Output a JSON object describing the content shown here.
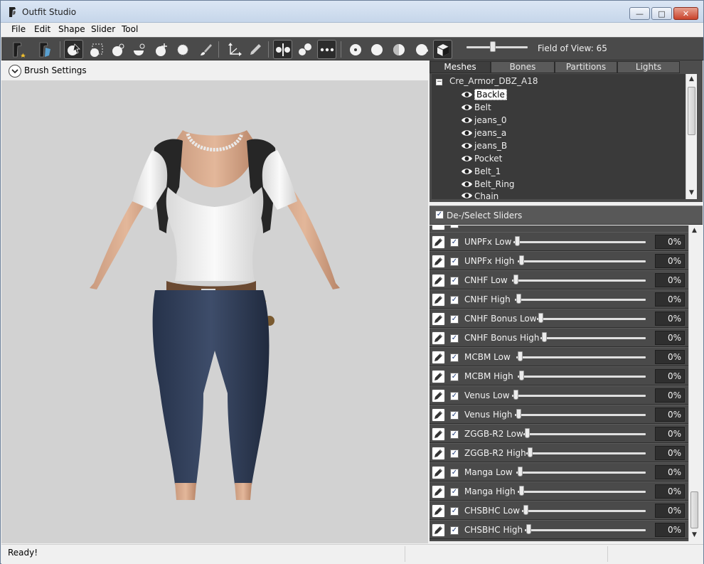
{
  "window": {
    "title": "Outfit Studio"
  },
  "menu": [
    "File",
    "Edit",
    "Shape",
    "Slider",
    "Tool"
  ],
  "toolbar": {
    "fov_label": "Field of View: 65",
    "fov_value": 65
  },
  "brush": {
    "label": "Brush Settings"
  },
  "tabs": [
    "Meshes",
    "Bones",
    "Partitions",
    "Lights"
  ],
  "tree": {
    "root": "Cre_Armor_DBZ_A18",
    "meshes": [
      "Backle",
      "Belt",
      "jeans_0",
      "jeans_a",
      "jeans_B",
      "Pocket",
      "Belt_1",
      "Belt_Ring",
      "Chain"
    ],
    "selected": "Backle"
  },
  "sliders_header": {
    "label": "De-/Select Sliders"
  },
  "sliders": [
    {
      "name": "UNPFx Low",
      "value": "0%"
    },
    {
      "name": "UNPFx High",
      "value": "0%"
    },
    {
      "name": "CNHF Low",
      "value": "0%"
    },
    {
      "name": "CNHF High",
      "value": "0%"
    },
    {
      "name": "CNHF Bonus Low",
      "value": "0%"
    },
    {
      "name": "CNHF Bonus High",
      "value": "0%"
    },
    {
      "name": "MCBM Low",
      "value": "0%"
    },
    {
      "name": "MCBM High",
      "value": "0%"
    },
    {
      "name": "Venus Low",
      "value": "0%"
    },
    {
      "name": "Venus High",
      "value": "0%"
    },
    {
      "name": "ZGGB-R2 Low",
      "value": "0%"
    },
    {
      "name": "ZGGB-R2 High",
      "value": "0%"
    },
    {
      "name": "Manga Low",
      "value": "0%"
    },
    {
      "name": "Manga High",
      "value": "0%"
    },
    {
      "name": "CHSBHC Low",
      "value": "0%"
    },
    {
      "name": "CHSBHC High",
      "value": "0%"
    }
  ],
  "status": {
    "text": "Ready!"
  },
  "colors": {
    "panel": "#4a4a4a",
    "viewport": "#d2d2d2",
    "toolbar": "#4a4a4a"
  }
}
